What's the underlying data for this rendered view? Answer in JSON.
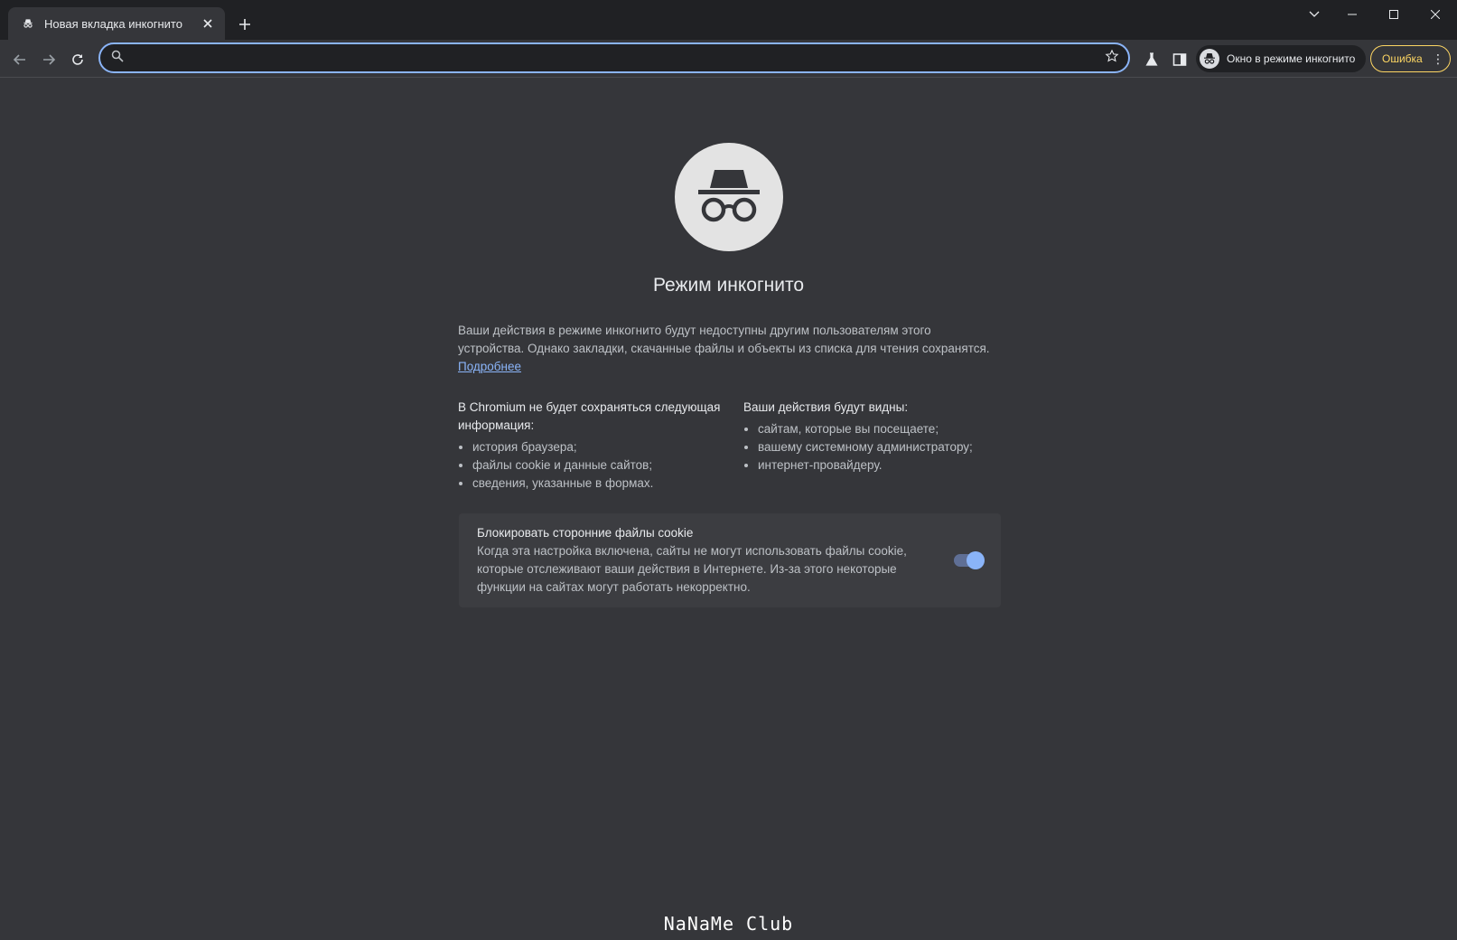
{
  "tab": {
    "title": "Новая вкладка инкогнито",
    "close_label": "✕"
  },
  "new_tab_label": "+",
  "window": {
    "minimize": "—",
    "maximize": "☐",
    "close": "✕"
  },
  "omnibox": {
    "value": "",
    "placeholder": ""
  },
  "profile_chip": {
    "label": "Окно в режиме инкогнито"
  },
  "error_chip": {
    "label": "Ошибка",
    "menu": "⋮"
  },
  "page": {
    "heading": "Режим инкогнито",
    "intro": "Ваши действия в режиме инкогнито будут недоступны другим пользователям этого устройства. Однако закладки, скачанные файлы и объекты из списка для чтения сохранятся.",
    "learn_more": "Подробнее",
    "not_saved": {
      "heading": "В Chromium не будет сохраняться следующая информация:",
      "items": [
        "история браузера;",
        "файлы cookie и данные сайтов;",
        "сведения, указанные в формах."
      ]
    },
    "visible_to": {
      "heading": "Ваши действия будут видны:",
      "items": [
        "сайтам, которые вы посещаете;",
        "вашему системному администратору;",
        "интернет-провайдеру."
      ]
    },
    "cookie": {
      "title": "Блокировать сторонние файлы cookie",
      "description": "Когда эта настройка включена, сайты не могут использовать файлы cookie, которые отслеживают ваши действия в Интернете. Из-за этого некоторые функции на сайтах могут работать некорректно.",
      "enabled": true
    }
  },
  "watermark": "NaNaMe Club",
  "colors": {
    "accent": "#8ab4f8",
    "background": "#35363a",
    "frame": "#202124",
    "warning": "#fdd663"
  },
  "icons": [
    "incognito-icon",
    "close-icon",
    "plus-icon",
    "chevron-down-icon",
    "minimize-icon",
    "maximize-icon",
    "back-icon",
    "forward-icon",
    "reload-icon",
    "search-icon",
    "star-icon",
    "labs-icon",
    "side-panel-icon",
    "more-icon"
  ]
}
